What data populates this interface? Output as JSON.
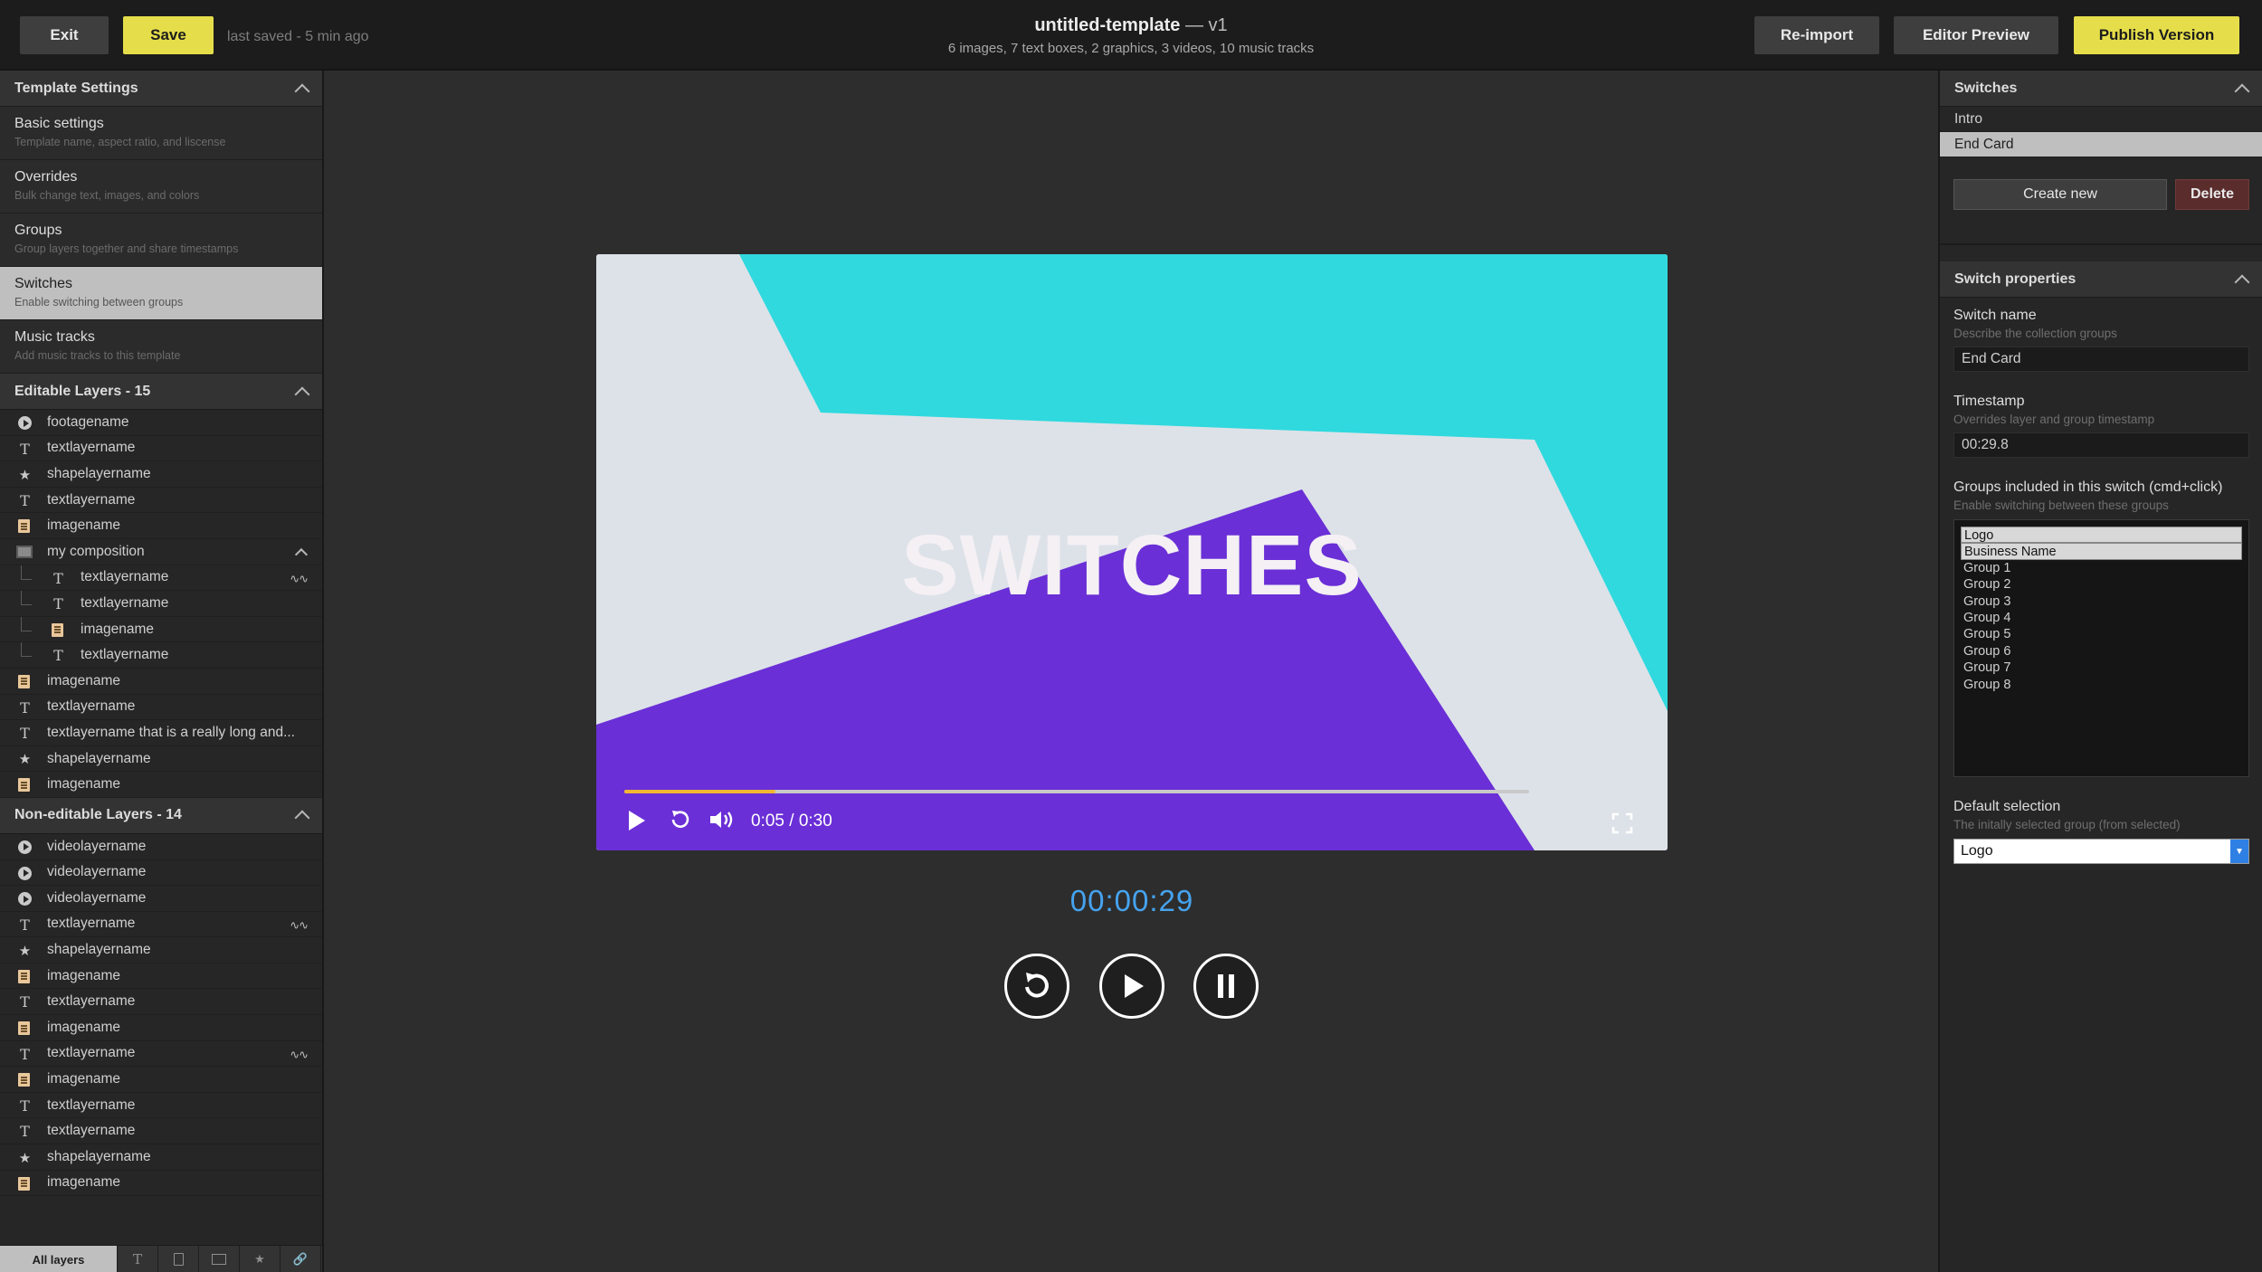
{
  "topbar": {
    "exit": "Exit",
    "save": "Save",
    "last_saved": "last saved - 5 min ago",
    "title": "untitled-template",
    "version": "— v1",
    "subtitle": "6 images, 7 text boxes, 2 graphics, 3 videos, 10 music tracks",
    "reimport": "Re-import",
    "editor_preview": "Editor Preview",
    "publish": "Publish Version"
  },
  "template_settings": {
    "heading": "Template Settings",
    "items": [
      {
        "title": "Basic settings",
        "desc": "Template name, aspect ratio, and liscense"
      },
      {
        "title": "Overrides",
        "desc": "Bulk change text, images, and colors"
      },
      {
        "title": "Groups",
        "desc": "Group layers together and share timestamps"
      },
      {
        "title": "Switches",
        "desc": "Enable switching between groups"
      },
      {
        "title": "Music tracks",
        "desc": "Add music tracks to this template"
      }
    ],
    "active_index": 3
  },
  "editable_layers": {
    "heading": "Editable Layers - 15",
    "items": [
      {
        "name": "footagename",
        "icon": "video-icon"
      },
      {
        "name": "textlayername",
        "icon": "text-icon"
      },
      {
        "name": "shapelayername",
        "icon": "shape-icon"
      },
      {
        "name": "textlayername",
        "icon": "text-icon"
      },
      {
        "name": "imagename",
        "icon": "image-icon"
      },
      {
        "name": "my composition",
        "icon": "composition-icon"
      },
      {
        "name": "textlayername",
        "icon": "text-icon"
      },
      {
        "name": "textlayername",
        "icon": "text-icon"
      },
      {
        "name": "imagename",
        "icon": "image-icon"
      },
      {
        "name": "textlayername",
        "icon": "text-icon"
      },
      {
        "name": "imagename",
        "icon": "image-icon"
      },
      {
        "name": "textlayername",
        "icon": "text-icon"
      },
      {
        "name": "textlayername that is a really long and...",
        "icon": "text-icon"
      },
      {
        "name": "shapelayername",
        "icon": "shape-icon"
      },
      {
        "name": "imagename",
        "icon": "image-icon"
      }
    ]
  },
  "noneditable_layers": {
    "heading": "Non-editable Layers - 14",
    "items": [
      {
        "name": "videolayername",
        "icon": "video-icon"
      },
      {
        "name": "videolayername",
        "icon": "video-icon"
      },
      {
        "name": "videolayername",
        "icon": "video-icon"
      },
      {
        "name": "textlayername",
        "icon": "text-icon"
      },
      {
        "name": "shapelayername",
        "icon": "shape-icon"
      },
      {
        "name": "imagename",
        "icon": "image-icon"
      },
      {
        "name": "textlayername",
        "icon": "text-icon"
      },
      {
        "name": "imagename",
        "icon": "image-icon"
      },
      {
        "name": "textlayername",
        "icon": "text-icon"
      },
      {
        "name": "imagename",
        "icon": "image-icon"
      },
      {
        "name": "textlayername",
        "icon": "text-icon"
      },
      {
        "name": "textlayername",
        "icon": "text-icon"
      },
      {
        "name": "shapelayername",
        "icon": "shape-icon"
      },
      {
        "name": "imagename",
        "icon": "image-icon"
      }
    ]
  },
  "bottom_tabs": {
    "all_layers": "All layers",
    "icons": [
      "text-icon",
      "image-icon",
      "composition-icon",
      "shape-icon",
      "link-icon"
    ]
  },
  "preview": {
    "headline": "SWITCHES",
    "time": "0:05 / 0:30",
    "progress": 0.167,
    "timecode": "00:00:29",
    "colors": {
      "cyan": "#2fd9de",
      "purple": "#6a2fd6",
      "white": "#dde2e8",
      "progress": "#f2b632",
      "timecode": "#46a3ee"
    }
  },
  "switches": {
    "heading": "Switches",
    "items": [
      "Intro",
      "End Card"
    ],
    "active_index": 1,
    "create_new": "Create new",
    "delete": "Delete"
  },
  "switch_properties": {
    "heading": "Switch properties",
    "name_label": "Switch name",
    "name_desc": "Describe the collection groups",
    "name_value": "End Card",
    "timestamp_label": "Timestamp",
    "timestamp_desc": "Overrides layer and group timestamp",
    "timestamp_value": "00:29.8",
    "groups_label": "Groups included in this switch (cmd+click)",
    "groups_desc": "Enable switching between these groups",
    "groups": [
      "Logo",
      "Business Name",
      "Group 1",
      "Group 2",
      "Group 3",
      "Group 4",
      "Group 5",
      "Group 6",
      "Group 7",
      "Group 8"
    ],
    "groups_selected": [
      0,
      1
    ],
    "default_label": "Default selection",
    "default_desc": "The initally selected group (from selected)",
    "default_value": "Logo"
  }
}
